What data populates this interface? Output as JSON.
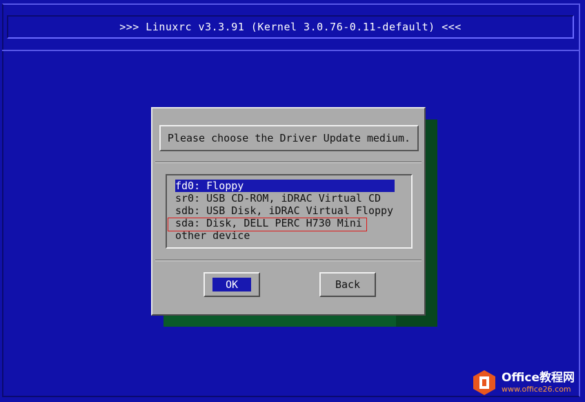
{
  "header": {
    "title": ">>> Linuxrc v3.3.91 (Kernel 3.0.76-0.11-default) <<<"
  },
  "dialog": {
    "message": "Please choose the Driver Update medium.",
    "items": [
      {
        "label": "fd0: Floppy",
        "selected": true
      },
      {
        "label": "sr0: USB CD-ROM, iDRAC Virtual CD",
        "selected": false
      },
      {
        "label": "sdb: USB Disk, iDRAC Virtual Floppy",
        "selected": false
      },
      {
        "label": "sda: Disk, DELL PERC H730 Mini",
        "selected": false,
        "annotated": true
      },
      {
        "label": "other device",
        "selected": false
      }
    ],
    "buttons": {
      "ok": "OK",
      "back": "Back"
    }
  },
  "colors": {
    "background": "#1111aa",
    "dialog": "#ababab",
    "selection": "#1818b0",
    "annotation": "#e01818"
  },
  "watermark": {
    "name": "Office教程网",
    "url": "www.office26.com",
    "icon": "office-logo-icon"
  }
}
